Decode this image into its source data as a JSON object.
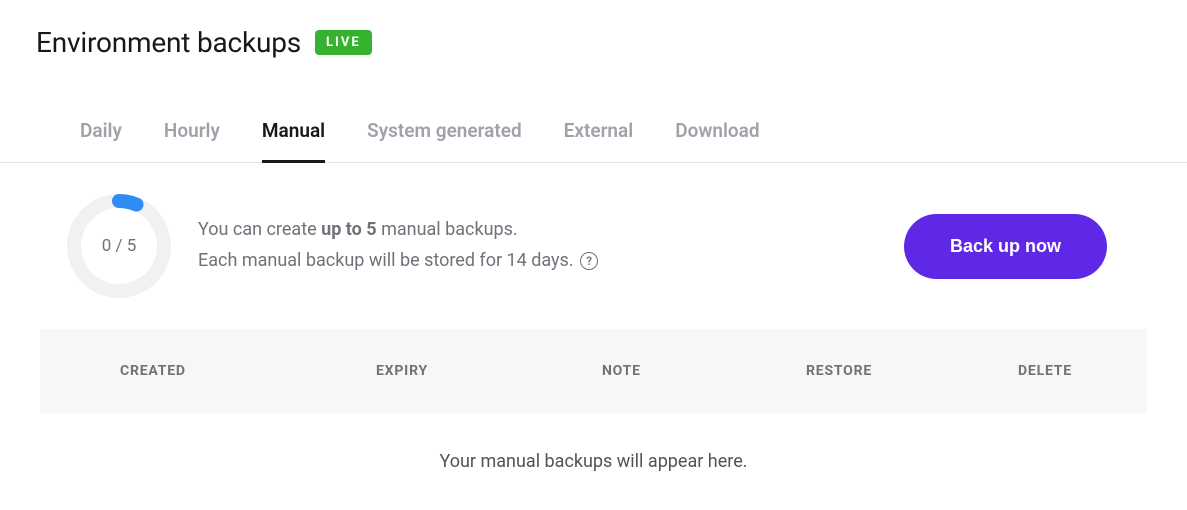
{
  "header": {
    "title": "Environment backups",
    "badge": "LIVE"
  },
  "tabs": [
    {
      "label": "Daily",
      "active": false
    },
    {
      "label": "Hourly",
      "active": false
    },
    {
      "label": "Manual",
      "active": true
    },
    {
      "label": "System generated",
      "active": false
    },
    {
      "label": "External",
      "active": false
    },
    {
      "label": "Download",
      "active": false
    }
  ],
  "progress": {
    "label": "0 / 5",
    "used": 0,
    "max": 5
  },
  "info": {
    "line1_pre": "You can create ",
    "line1_bold": "up to 5",
    "line1_post": " manual backups.",
    "line2": "Each manual backup will be stored for 14 days."
  },
  "action": {
    "backup_button": "Back up now"
  },
  "table": {
    "headers": {
      "created": "CREATED",
      "expiry": "EXPIRY",
      "note": "NOTE",
      "restore": "RESTORE",
      "delete": "DELETE"
    },
    "rows": [],
    "empty_message": "Your manual backups will appear here."
  }
}
